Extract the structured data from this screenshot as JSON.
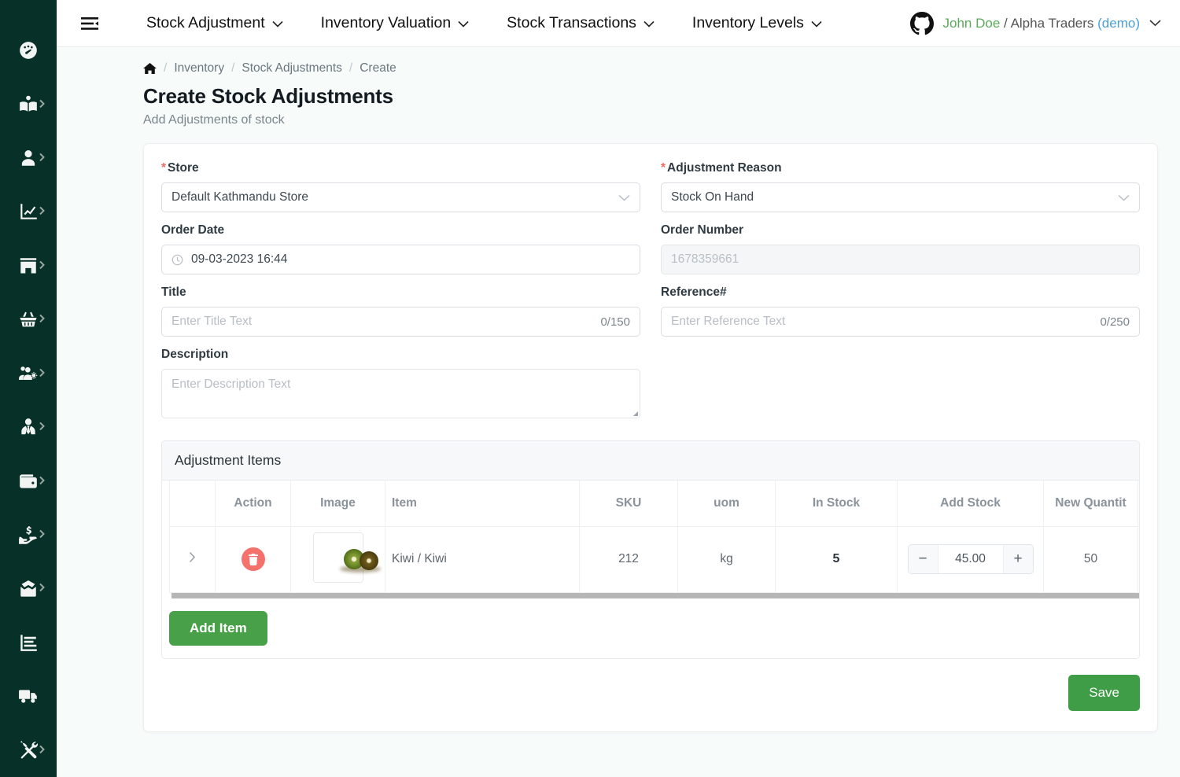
{
  "sidebar": {
    "items": [
      {
        "name": "dashboard",
        "icon": "gauge-icon",
        "submenu": false
      },
      {
        "name": "catalog",
        "icon": "book-open-reader-icon",
        "submenu": true
      },
      {
        "name": "customers",
        "icon": "user-icon",
        "submenu": true
      },
      {
        "name": "analytics",
        "icon": "chart-line-icon",
        "submenu": true
      },
      {
        "name": "stores",
        "icon": "store-icon",
        "submenu": true
      },
      {
        "name": "purchases",
        "icon": "basket-icon",
        "submenu": true
      },
      {
        "name": "user-management",
        "icon": "users-gear-icon",
        "submenu": true
      },
      {
        "name": "employees",
        "icon": "user-tie-icon",
        "submenu": true
      },
      {
        "name": "payments",
        "icon": "wallet-icon",
        "submenu": true
      },
      {
        "name": "expenses",
        "icon": "hand-holding-dollar-icon",
        "submenu": true
      },
      {
        "name": "inbox",
        "icon": "inbox-icon",
        "submenu": true
      },
      {
        "name": "reports",
        "icon": "chart-bar-icon",
        "submenu": false
      },
      {
        "name": "shipping",
        "icon": "truck-icon",
        "submenu": false
      },
      {
        "name": "settings",
        "icon": "tools-icon",
        "submenu": true
      }
    ]
  },
  "topbar": {
    "menu_toggle_icon": "bars-staggered-icon",
    "nav": [
      {
        "label": "Stock Adjustment",
        "icon": "chevron-down-icon"
      },
      {
        "label": "Inventory Valuation",
        "icon": "chevron-down-icon"
      },
      {
        "label": "Stock Transactions",
        "icon": "chevron-down-icon"
      },
      {
        "label": "Inventory Levels",
        "icon": "chevron-down-icon"
      }
    ],
    "user": {
      "logo_icon": "github-icon",
      "name": "John Doe",
      "separator": "/",
      "org": "Alpha Traders",
      "mode": "(demo)",
      "caret_icon": "chevron-down-icon"
    }
  },
  "breadcrumb": {
    "home_icon": "home-icon",
    "items": [
      "Inventory",
      "Stock Adjustments",
      "Create"
    ],
    "separator": "/"
  },
  "page": {
    "title": "Create Stock Adjustments",
    "subtitle": "Add Adjustments of stock"
  },
  "form": {
    "store": {
      "label": "Store",
      "required": true,
      "value": "Default Kathmandu Store",
      "caret_icon": "chevron-down-icon"
    },
    "adjustment_reason": {
      "label": "Adjustment Reason",
      "required": true,
      "value": "Stock On Hand",
      "caret_icon": "chevron-down-icon"
    },
    "order_date": {
      "label": "Order Date",
      "value": "09-03-2023 16:44",
      "icon": "clock-icon"
    },
    "order_number": {
      "label": "Order Number",
      "value": "1678359661",
      "disabled": true
    },
    "title": {
      "label": "Title",
      "value": "",
      "placeholder": "Enter Title Text",
      "counter": "0/150"
    },
    "reference": {
      "label": "Reference#",
      "value": "",
      "placeholder": "Enter Reference Text",
      "counter": "0/250"
    },
    "description": {
      "label": "Description",
      "value": "",
      "placeholder": "Enter Description Text"
    }
  },
  "items_panel": {
    "title": "Adjustment Items",
    "columns": [
      "",
      "Action",
      "Image",
      "Item",
      "SKU",
      "uom",
      "In Stock",
      "Add Stock",
      "New Quantit"
    ],
    "rows": [
      {
        "expand_icon": "chevron-right-icon",
        "delete_icon": "trash-icon",
        "image": "kiwi-thumbnail",
        "item": "Kiwi / Kiwi",
        "sku": "212",
        "uom": "kg",
        "in_stock": "5",
        "add_stock": "45.00",
        "minus_label": "−",
        "plus_label": "+",
        "new_quantity": "50"
      }
    ],
    "add_item_label": "Add Item"
  },
  "actions": {
    "save_label": "Save"
  },
  "colors": {
    "sidebar": "#073028",
    "accent_green": "#48a148",
    "danger": "#f4726b",
    "required": "#f06a61",
    "user_name": "#5aab5a",
    "demo": "#4a9fd4"
  }
}
